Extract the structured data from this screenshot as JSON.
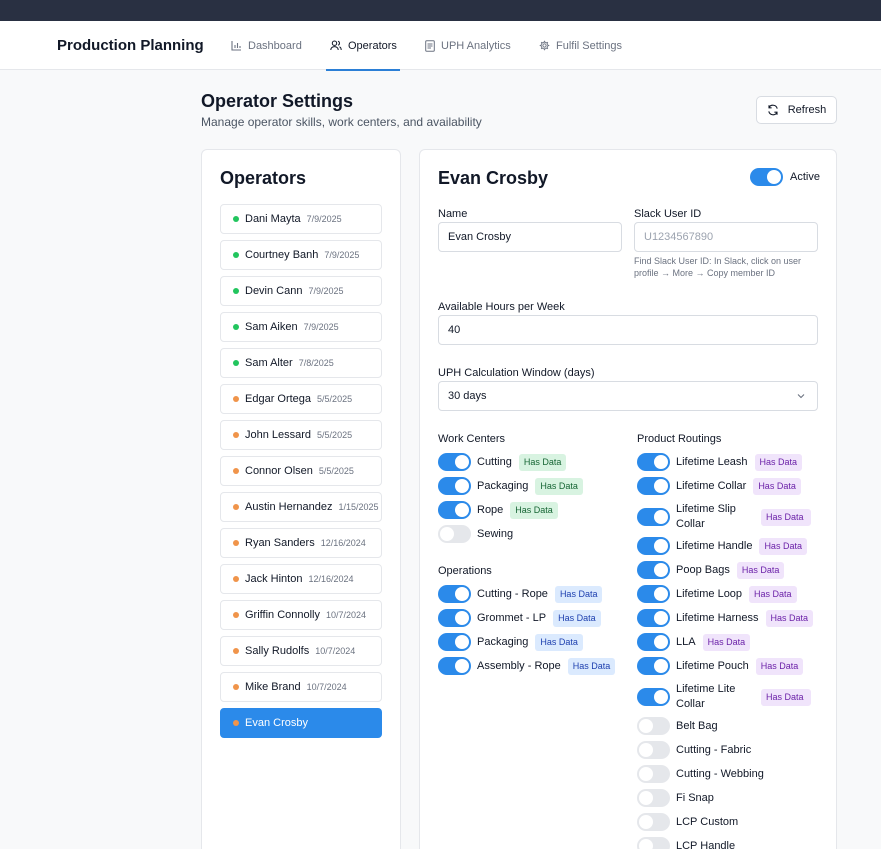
{
  "nav": {
    "brand": "Production Planning",
    "tabs": [
      {
        "label": "Dashboard",
        "icon": "bar-chart-icon"
      },
      {
        "label": "Operators",
        "icon": "users-icon"
      },
      {
        "label": "UPH Analytics",
        "icon": "document-icon"
      },
      {
        "label": "Fulfil Settings",
        "icon": "gear-icon"
      }
    ],
    "active_tab": "Operators"
  },
  "page": {
    "title": "Operator Settings",
    "subtitle": "Manage operator skills, work centers, and availability",
    "refresh_label": "Refresh"
  },
  "operators_panel": {
    "title": "Operators",
    "items": [
      {
        "name": "Dani Mayta",
        "date": "7/9/2025",
        "status": "green"
      },
      {
        "name": "Courtney Banh",
        "date": "7/9/2025",
        "status": "green"
      },
      {
        "name": "Devin Cann",
        "date": "7/9/2025",
        "status": "green"
      },
      {
        "name": "Sam Aiken",
        "date": "7/9/2025",
        "status": "green"
      },
      {
        "name": "Sam Alter",
        "date": "7/8/2025",
        "status": "green"
      },
      {
        "name": "Edgar Ortega",
        "date": "5/5/2025",
        "status": "orange"
      },
      {
        "name": "John Lessard",
        "date": "5/5/2025",
        "status": "orange"
      },
      {
        "name": "Connor Olsen",
        "date": "5/5/2025",
        "status": "orange"
      },
      {
        "name": "Austin Hernandez",
        "date": "1/15/2025",
        "status": "orange"
      },
      {
        "name": "Ryan Sanders",
        "date": "12/16/2024",
        "status": "orange"
      },
      {
        "name": "Jack Hinton",
        "date": "12/16/2024",
        "status": "orange"
      },
      {
        "name": "Griffin Connolly",
        "date": "10/7/2024",
        "status": "orange"
      },
      {
        "name": "Sally Rudolfs",
        "date": "10/7/2024",
        "status": "orange"
      },
      {
        "name": "Mike Brand",
        "date": "10/7/2024",
        "status": "orange"
      },
      {
        "name": "Evan Crosby",
        "date": "",
        "status": "orange",
        "selected": true
      }
    ]
  },
  "detail": {
    "title": "Evan Crosby",
    "active_label": "Active",
    "active": true,
    "name_label": "Name",
    "name_value": "Evan Crosby",
    "slack_label": "Slack User ID",
    "slack_placeholder": "U1234567890",
    "slack_hint": "Find Slack User ID: In Slack, click on user profile → More → Copy member ID",
    "hours_label": "Available Hours per Week",
    "hours_value": "40",
    "uph_label": "UPH Calculation Window (days)",
    "uph_value": "30 days",
    "work_centers_label": "Work Centers",
    "work_centers": [
      {
        "label": "Cutting",
        "on": true,
        "badge": "Has Data"
      },
      {
        "label": "Packaging",
        "on": true,
        "badge": "Has Data"
      },
      {
        "label": "Rope",
        "on": true,
        "badge": "Has Data"
      },
      {
        "label": "Sewing",
        "on": false,
        "badge": ""
      }
    ],
    "operations_label": "Operations",
    "operations": [
      {
        "label": "Cutting - Rope",
        "on": true,
        "badge": "Has Data"
      },
      {
        "label": "Grommet - LP",
        "on": true,
        "badge": "Has Data"
      },
      {
        "label": "Packaging",
        "on": true,
        "badge": "Has Data"
      },
      {
        "label": "Assembly - Rope",
        "on": true,
        "badge": "Has Data"
      }
    ],
    "routings_label": "Product Routings",
    "routings": [
      {
        "label": "Lifetime Leash",
        "on": true,
        "badge": "Has Data"
      },
      {
        "label": "Lifetime Collar",
        "on": true,
        "badge": "Has Data"
      },
      {
        "label": "Lifetime Slip Collar",
        "on": true,
        "badge": "Has Data"
      },
      {
        "label": "Lifetime Handle",
        "on": true,
        "badge": "Has Data"
      },
      {
        "label": "Poop Bags",
        "on": true,
        "badge": "Has Data"
      },
      {
        "label": "Lifetime Loop",
        "on": true,
        "badge": "Has Data"
      },
      {
        "label": "Lifetime Harness",
        "on": true,
        "badge": "Has Data"
      },
      {
        "label": "LLA",
        "on": true,
        "badge": "Has Data"
      },
      {
        "label": "Lifetime Pouch",
        "on": true,
        "badge": "Has Data"
      },
      {
        "label": "Lifetime Lite Collar",
        "on": true,
        "badge": "Has Data"
      },
      {
        "label": "Belt Bag",
        "on": false,
        "badge": ""
      },
      {
        "label": "Cutting - Fabric",
        "on": false,
        "badge": ""
      },
      {
        "label": "Cutting - Webbing",
        "on": false,
        "badge": ""
      },
      {
        "label": "Fi Snap",
        "on": false,
        "badge": ""
      },
      {
        "label": "LCP Custom",
        "on": false,
        "badge": ""
      },
      {
        "label": "LCP Handle",
        "on": false,
        "badge": ""
      }
    ]
  },
  "colors": {
    "accent": "#2b8aea",
    "status_green": "#22c55e",
    "status_orange": "#f0944a",
    "topbar": "#293042"
  }
}
